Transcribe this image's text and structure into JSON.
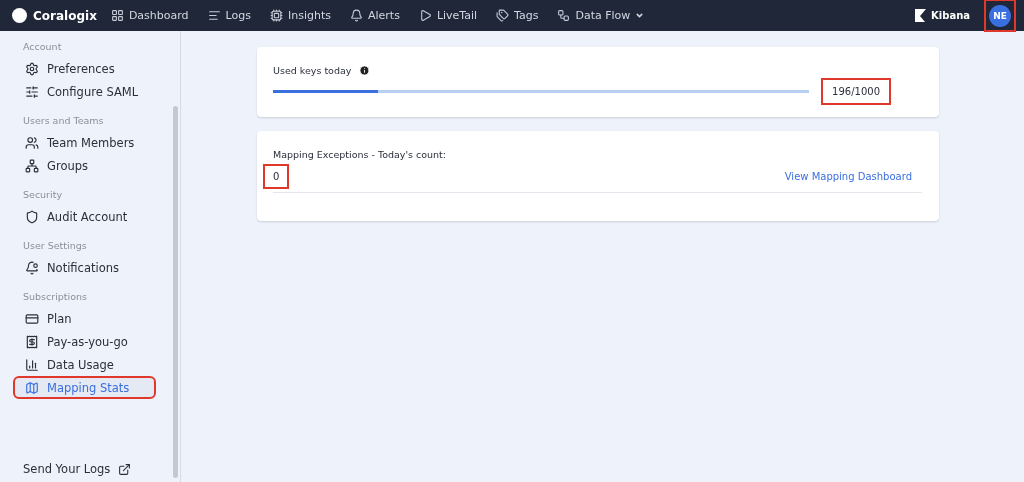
{
  "topbar": {
    "brand": "Coralogix",
    "nav": [
      {
        "kind": "dashboard",
        "label": "Dashboard",
        "dropdown": false
      },
      {
        "kind": "logs",
        "label": "Logs",
        "dropdown": false
      },
      {
        "kind": "insights",
        "label": "Insights",
        "dropdown": false
      },
      {
        "kind": "alerts",
        "label": "Alerts",
        "dropdown": false
      },
      {
        "kind": "livetail",
        "label": "LiveTail",
        "dropdown": false
      },
      {
        "kind": "tags",
        "label": "Tags",
        "dropdown": false
      },
      {
        "kind": "dataflow",
        "label": "Data Flow",
        "dropdown": true
      }
    ],
    "kibana": "Kibana",
    "avatar": {
      "initials": "NE",
      "highlighted": true
    }
  },
  "sidebar": {
    "sections": [
      {
        "title": "Account",
        "items": [
          {
            "kind": "preferences",
            "label": "Preferences",
            "selected": false,
            "highlighted": false
          },
          {
            "kind": "saml",
            "label": "Configure SAML",
            "selected": false,
            "highlighted": false
          }
        ]
      },
      {
        "title": "Users and Teams",
        "items": [
          {
            "kind": "team",
            "label": "Team Members",
            "selected": false,
            "highlighted": false
          },
          {
            "kind": "groups",
            "label": "Groups",
            "selected": false,
            "highlighted": false
          }
        ]
      },
      {
        "title": "Security",
        "items": [
          {
            "kind": "audit",
            "label": "Audit Account",
            "selected": false,
            "highlighted": false
          }
        ]
      },
      {
        "title": "User Settings",
        "items": [
          {
            "kind": "notifications",
            "label": "Notifications",
            "selected": false,
            "highlighted": false
          }
        ]
      },
      {
        "title": "Subscriptions",
        "items": [
          {
            "kind": "plan",
            "label": "Plan",
            "selected": false,
            "highlighted": false
          },
          {
            "kind": "payg",
            "label": "Pay-as-you-go",
            "selected": false,
            "highlighted": false
          },
          {
            "kind": "usage",
            "label": "Data Usage",
            "selected": false,
            "highlighted": false
          },
          {
            "kind": "map",
            "label": "Mapping Stats",
            "selected": true,
            "highlighted": true
          }
        ]
      }
    ],
    "footer_link": "Send Your Logs"
  },
  "keys_card": {
    "title": "Used keys today",
    "level": 0.196,
    "reading": "196/1000",
    "reading_highlighted": true
  },
  "exceptions_card": {
    "title": "Mapping Exceptions - Today's count:",
    "count": "0",
    "count_highlighted": true,
    "link": "View Mapping Dashboard"
  }
}
